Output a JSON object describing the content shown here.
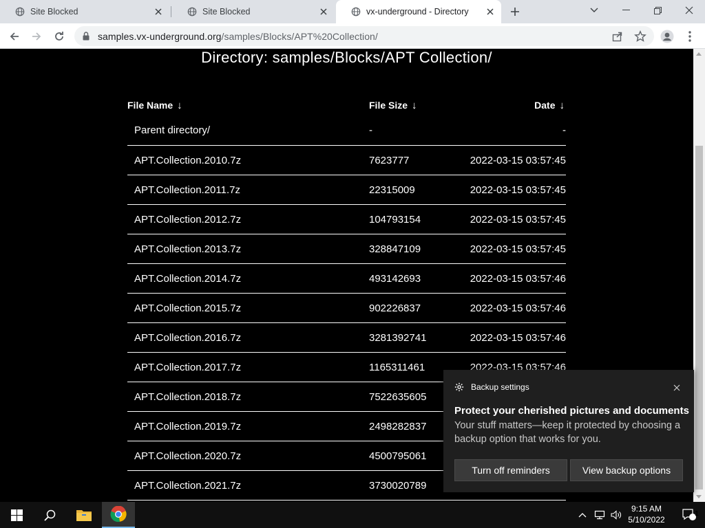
{
  "browser": {
    "tabs": [
      {
        "title": "Site Blocked",
        "active": false
      },
      {
        "title": "Site Blocked",
        "active": false
      },
      {
        "title": "vx-underground - Directory",
        "active": true
      }
    ],
    "url": {
      "host": "samples.vx-underground.org",
      "path": "/samples/Blocks/APT%20Collection/"
    }
  },
  "page": {
    "title": "Directory: samples/Blocks/APT Collection/",
    "columns": {
      "name": "File Name",
      "size": "File Size",
      "date": "Date",
      "sort_arrow": "↓"
    },
    "parent": {
      "name": "Parent directory/",
      "size": "-",
      "date": "-"
    },
    "files": [
      {
        "name": "APT.Collection.2010.7z",
        "size": "7623777",
        "date": "2022-03-15 03:57:45"
      },
      {
        "name": "APT.Collection.2011.7z",
        "size": "22315009",
        "date": "2022-03-15 03:57:45"
      },
      {
        "name": "APT.Collection.2012.7z",
        "size": "104793154",
        "date": "2022-03-15 03:57:45"
      },
      {
        "name": "APT.Collection.2013.7z",
        "size": "328847109",
        "date": "2022-03-15 03:57:45"
      },
      {
        "name": "APT.Collection.2014.7z",
        "size": "493142693",
        "date": "2022-03-15 03:57:46"
      },
      {
        "name": "APT.Collection.2015.7z",
        "size": "902226837",
        "date": "2022-03-15 03:57:46"
      },
      {
        "name": "APT.Collection.2016.7z",
        "size": "3281392741",
        "date": "2022-03-15 03:57:46"
      },
      {
        "name": "APT.Collection.2017.7z",
        "size": "1165311461",
        "date": "2022-03-15 03:57:46"
      },
      {
        "name": "APT.Collection.2018.7z",
        "size": "7522635605",
        "date": ""
      },
      {
        "name": "APT.Collection.2019.7z",
        "size": "2498282837",
        "date": ""
      },
      {
        "name": "APT.Collection.2020.7z",
        "size": "4500795061",
        "date": ""
      },
      {
        "name": "APT.Collection.2021.7z",
        "size": "3730020789",
        "date": ""
      }
    ]
  },
  "notification": {
    "app": "Backup settings",
    "title": "Protect your cherished pictures and documents",
    "body": "Your stuff matters—keep it protected by choosing a backup option that works for you.",
    "button_dismiss": "Turn off reminders",
    "button_action": "View backup options"
  },
  "taskbar": {
    "time": "9:15 AM",
    "date": "5/10/2022",
    "notification_count": "1"
  },
  "colors": {
    "page_bg": "#000000",
    "text": "#ffffff",
    "toast_bg": "#1f1f1f",
    "taskbar_bg": "#101010"
  }
}
